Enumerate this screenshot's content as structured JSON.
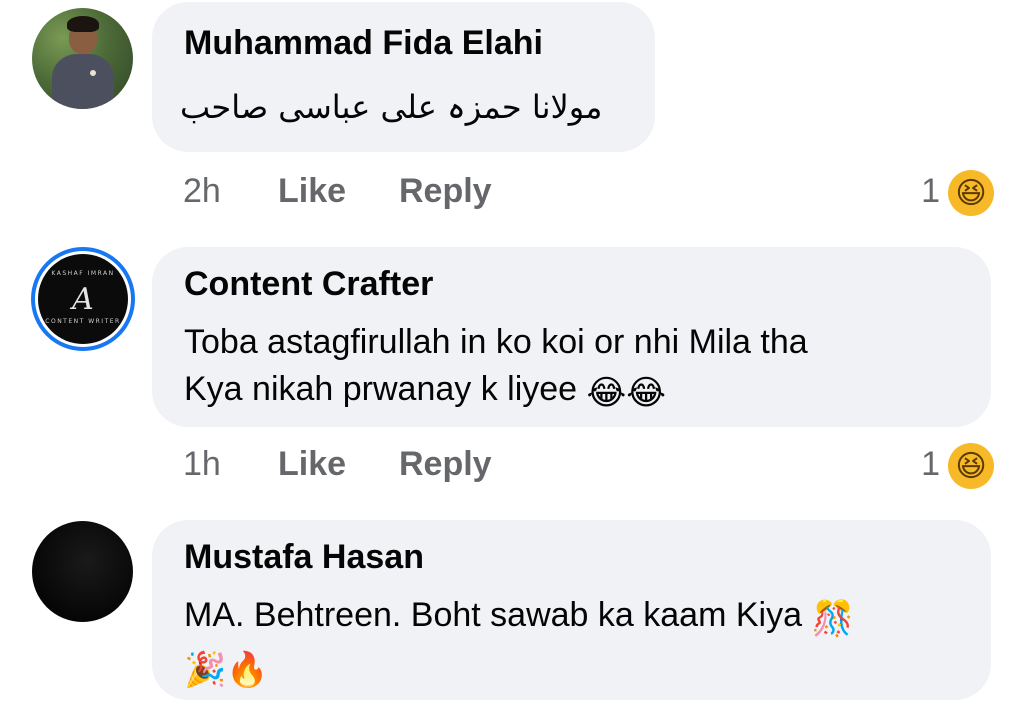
{
  "comments": [
    {
      "author": "Muhammad Fida Elahi",
      "text": "مولانا حمزہ علی عباسی صاحب",
      "time": "2h",
      "like_label": "Like",
      "reply_label": "Reply",
      "reaction_count": "1",
      "reaction_emoji": "😆",
      "emojis": ""
    },
    {
      "author": "Content Crafter",
      "text_line1": "Toba astagfirullah in ko koi or nhi Mila tha",
      "text_line2": "Kya nikah prwanay k liyee",
      "emojis": "😂😂",
      "avatar_mono": "A",
      "avatar_arc_top": "KASHAF IMRAN",
      "avatar_arc_bottom": "CONTENT WRITER",
      "time": "1h",
      "like_label": "Like",
      "reply_label": "Reply",
      "reaction_count": "1",
      "reaction_emoji": "😆"
    },
    {
      "author": "Mustafa Hasan",
      "text_line1": "MA. Behtreen. Boht sawab ka kaam Kiya",
      "emojis_line1": "🎊",
      "emojis_line2": "🎉🔥"
    }
  ],
  "colors": {
    "bubble": "#f0f2f5",
    "meta_text": "#65676b",
    "ring": "#1877f2",
    "reaction": "#f7b928"
  }
}
